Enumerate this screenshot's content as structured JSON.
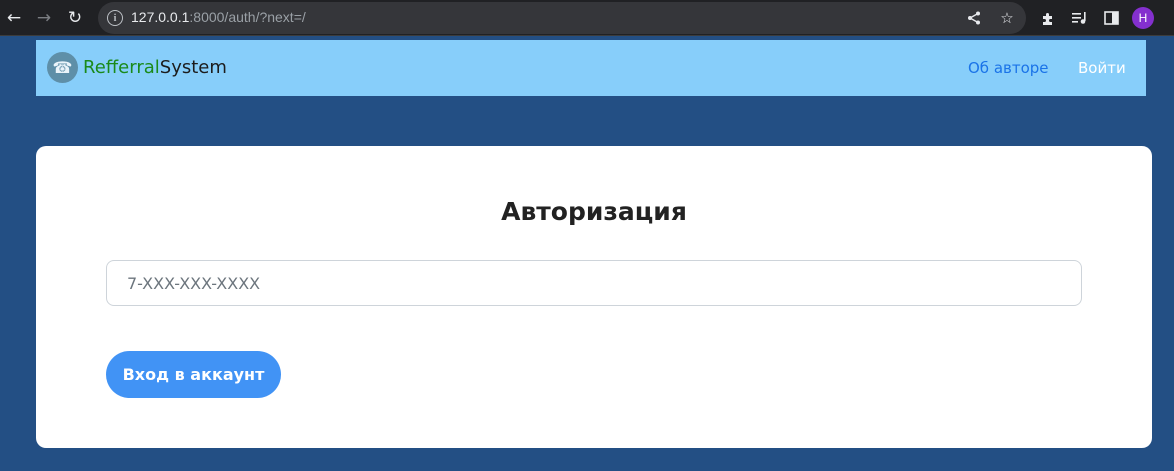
{
  "browser": {
    "url_host": "127.0.0.1",
    "url_rest": ":8000/auth/?next=/",
    "profile_initial": "H"
  },
  "navbar": {
    "brand_part1": "Refferral",
    "brand_part2": "System",
    "links": [
      {
        "label": "Об авторе"
      },
      {
        "label": "Войти"
      }
    ]
  },
  "auth": {
    "title": "Авторизация",
    "phone_placeholder": "7-XXX-XXX-XXXX",
    "phone_value": "",
    "submit_label": "Вход в аккаунт"
  },
  "colors": {
    "page_background": "#234f84",
    "navbar_background": "#87cefa",
    "brand_green": "#1a8a1a",
    "link_blue": "#1a73e8",
    "button_blue": "#4193f5"
  },
  "icons": {
    "back": "arrow-left-icon",
    "forward": "arrow-right-icon",
    "reload": "reload-icon",
    "site_info": "info-icon",
    "share": "share-icon",
    "bookmark": "star-icon",
    "extensions": "puzzle-icon",
    "media": "media-queue-icon",
    "side_panel": "side-panel-icon",
    "logo": "telephone-icon"
  }
}
